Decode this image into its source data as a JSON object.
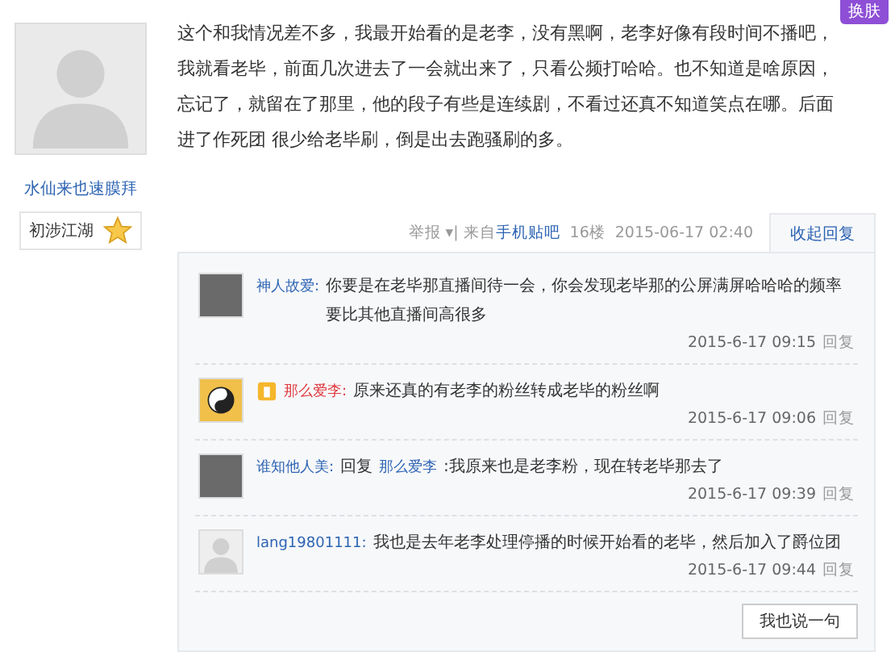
{
  "skin_button": "换肤",
  "post": {
    "author": {
      "name": "水仙来也速膜拜",
      "rank": "初涉江湖"
    },
    "body": "这个和我情况差不多，我最开始看的是老李，没有黑啊，老李好像有段时间不播吧，我就看老毕，前面几次进去了一会就出来了，只看公频打哈哈。也不知道是啥原因，忘记了，就留在了那里，他的段子有些是连续剧，不看过还真不知道笑点在哪。后面进了作死团 很少给老毕刷，倒是出去跑骚刷的多。",
    "meta": {
      "report": "举报 ▾",
      "source_prefix": "| 来自",
      "source": "手机贴吧",
      "floor": "16楼",
      "time": "2015-06-17 02:40"
    },
    "toggle": "收起回复"
  },
  "replies": [
    {
      "kind": "photo",
      "vip": false,
      "name": "神人故爱:",
      "text": "你要是在老毕那直播间待一会，你会发现老毕那的公屏满屏哈哈哈的频率要比其他直播间高很多",
      "time": "2015-6-17 09:15",
      "reply": "回复"
    },
    {
      "kind": "emblem",
      "vip": true,
      "name": "那么爱李:",
      "text": "原来还真的有老李的粉丝转成老毕的粉丝啊",
      "time": "2015-6-17 09:06",
      "reply": "回复"
    },
    {
      "kind": "photo",
      "vip": false,
      "name": "谁知他人美:",
      "reply_label": "回复",
      "reply_to": "那么爱李",
      "text": ":我原来也是老李粉，现在转老毕那去了",
      "time": "2015-6-17 09:39",
      "reply": "回复"
    },
    {
      "kind": "default",
      "vip": false,
      "name": "lang19801111:",
      "text": "我也是去年老李处理停播的时候开始看的老毕，然后加入了爵位团",
      "time": "2015-6-17 09:44",
      "reply": "回复"
    }
  ],
  "compose_button": "我也说一句"
}
